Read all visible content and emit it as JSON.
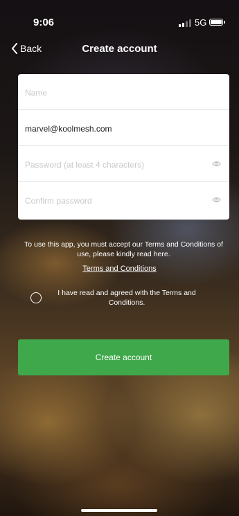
{
  "status_bar": {
    "time": "9:06",
    "network": "5G",
    "icons": [
      "signal-icon",
      "battery-icon"
    ]
  },
  "nav": {
    "back_label": "Back",
    "title": "Create account"
  },
  "form": {
    "name": {
      "placeholder": "Name",
      "value": ""
    },
    "email": {
      "placeholder": "",
      "value": "marvel@koolmesh.com"
    },
    "password": {
      "placeholder": "Password (at least 4 characters)",
      "value": ""
    },
    "confirm_password": {
      "placeholder": "Confirm password",
      "value": ""
    }
  },
  "terms": {
    "text": "To use this app, you must accept our Terms and Conditions of use, please kindly read here.",
    "link_label": "Terms and Conditions",
    "agree_label": "I have read and agreed with the Terms and Conditions.",
    "agreed": false
  },
  "actions": {
    "create_label": "Create account"
  },
  "colors": {
    "primary_button": "#3ea84a",
    "card_background": "#ffffff",
    "text_on_dark": "#ffffff"
  }
}
